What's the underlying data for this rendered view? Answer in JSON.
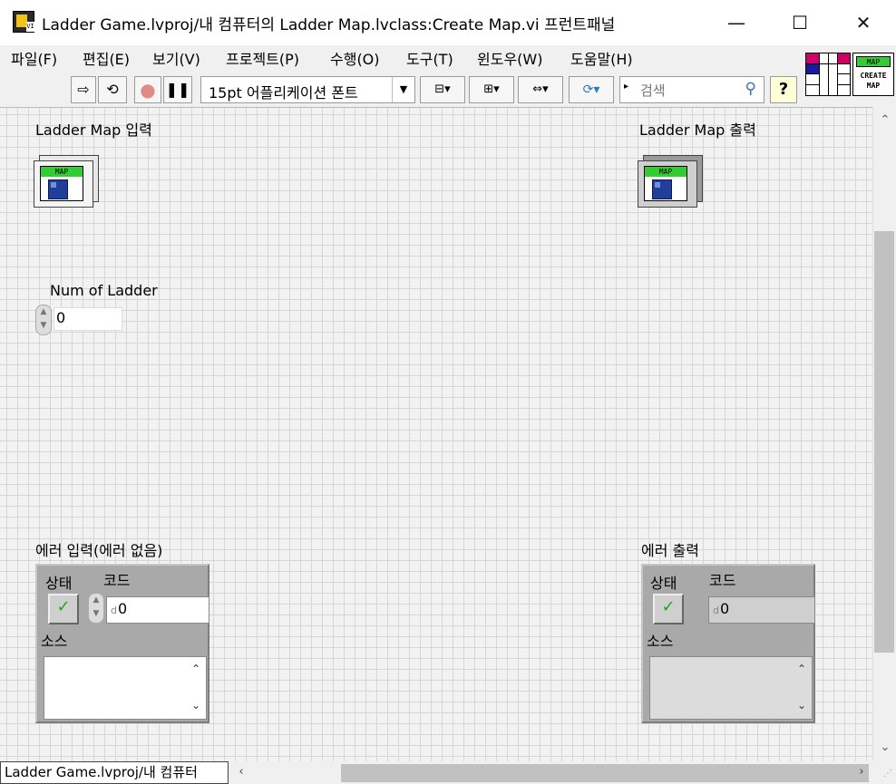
{
  "window": {
    "title": "Ladder Game.lvproj/내 컴퓨터의 Ladder Map.lvclass:Create Map.vi 프런트패널",
    "minimize_glyph": "—",
    "maximize_glyph": "☐",
    "close_glyph": "✕"
  },
  "menu": [
    "파일(F)",
    "편집(E)",
    "보기(V)",
    "프로젝트(P)",
    "수행(O)",
    "도구(T)",
    "윈도우(W)",
    "도움말(H)"
  ],
  "toolbar": {
    "font_select": "15pt 어플리케이션 폰트",
    "search_placeholder": "검색",
    "help": "?",
    "icons": [
      "run-arrow-icon",
      "run-continuously-icon",
      "abort-icon",
      "pause-icon",
      "align-objects-icon",
      "distribute-objects-icon",
      "resize-objects-icon",
      "reorder-icon"
    ]
  },
  "vi_icon": {
    "line1": "MAP",
    "line2": "CREATE",
    "line3": "MAP"
  },
  "controls": {
    "ladder_map_in": {
      "label": "Ladder Map 입력",
      "badge": "MAP"
    },
    "ladder_map_out": {
      "label": "Ladder Map 출력",
      "badge": "MAP"
    },
    "num_of_ladder": {
      "label": "Num of Ladder",
      "value": "0"
    },
    "error_in": {
      "label": "에러 입력(에러 없음)",
      "status_label": "상태",
      "code_label": "코드",
      "code_value": "0",
      "source_label": "소스",
      "status_check": "✓",
      "code_prefix": "d"
    },
    "error_out": {
      "label": "에러 출력",
      "status_label": "상태",
      "code_label": "코드",
      "code_value": "0",
      "source_label": "소스",
      "status_check": "✓",
      "code_prefix": "d"
    }
  },
  "statusbar": {
    "project_tab": "Ladder Game.lvproj/내 컴퓨터"
  },
  "colors": {
    "map_badge": "#33cc33",
    "cube": "#1f3f9a",
    "cluster": "#a9a9a9",
    "check": "#1aa81a"
  }
}
